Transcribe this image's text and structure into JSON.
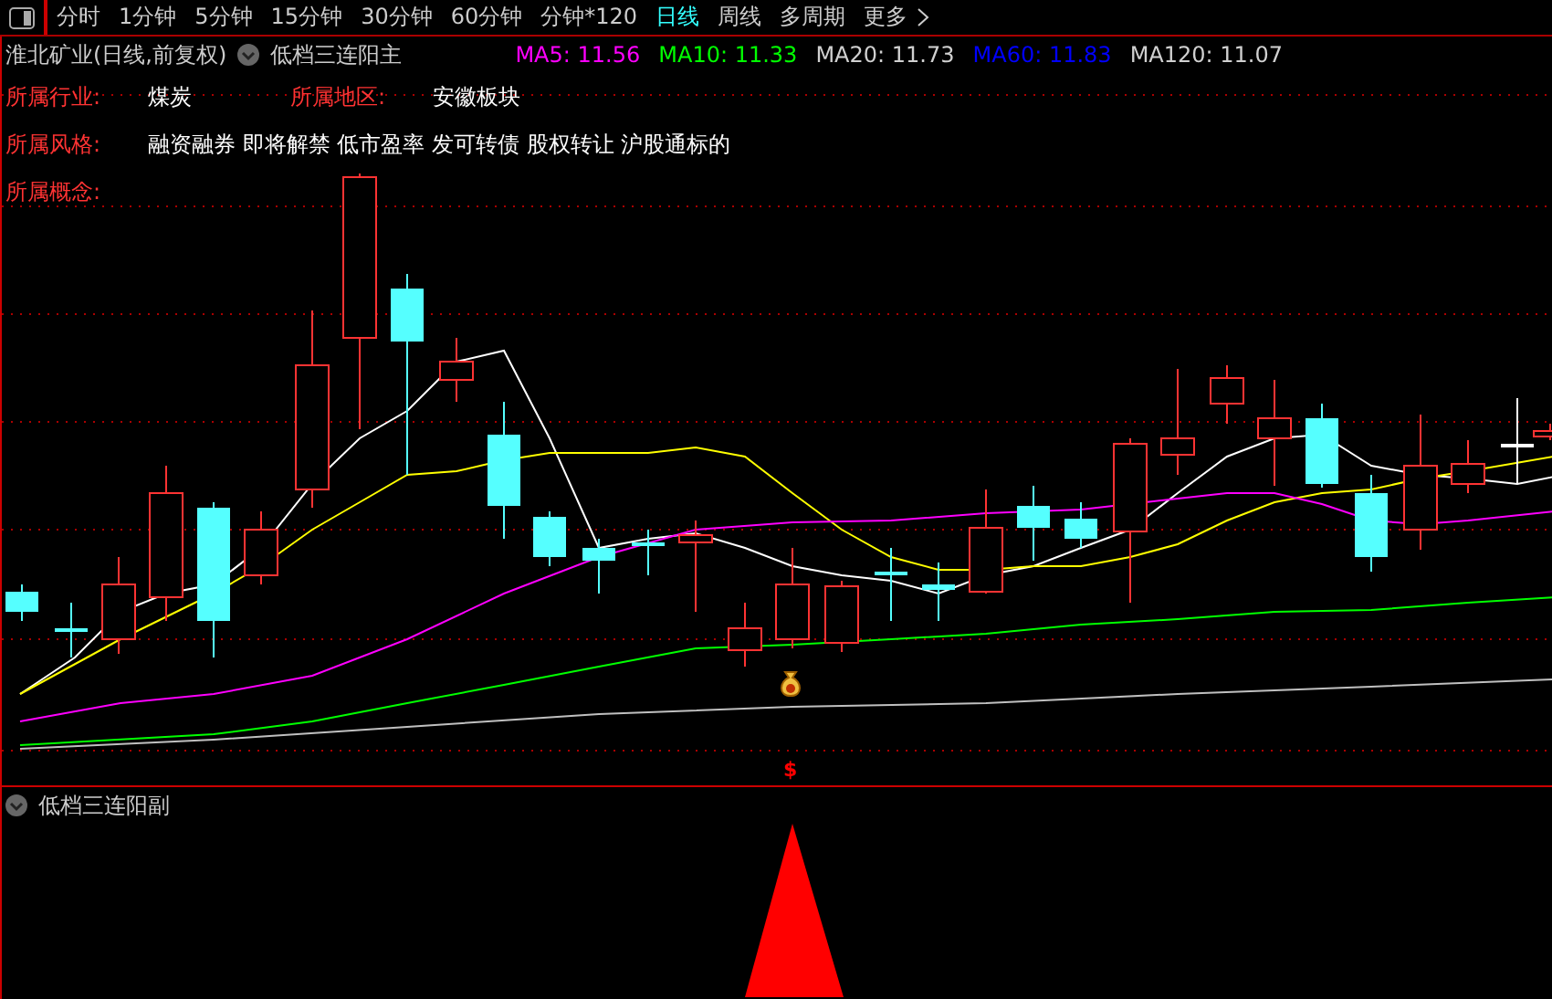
{
  "toolbar": {
    "periods": [
      {
        "label": "分时",
        "selected": false
      },
      {
        "label": "1分钟",
        "selected": false
      },
      {
        "label": "5分钟",
        "selected": false
      },
      {
        "label": "15分钟",
        "selected": false
      },
      {
        "label": "30分钟",
        "selected": false
      },
      {
        "label": "60分钟",
        "selected": false
      },
      {
        "label": "分钟*120",
        "selected": false
      },
      {
        "label": "日线",
        "selected": true
      },
      {
        "label": "周线",
        "selected": false
      },
      {
        "label": "多周期",
        "selected": false
      },
      {
        "label": "更多",
        "selected": false
      }
    ]
  },
  "main_pane": {
    "stock": "淮北矿业(日线,前复权)",
    "indicator": "低档三连阳主",
    "ma": [
      {
        "label": "MA5:",
        "value": "11.56",
        "color": "#ff00ff"
      },
      {
        "label": "MA10:",
        "value": "11.33",
        "color": "#00ff00"
      },
      {
        "label": "MA20:",
        "value": "11.73",
        "color": "#d0d0d0"
      },
      {
        "label": "MA60:",
        "value": "11.83",
        "color": "#0000ff"
      },
      {
        "label": "MA120:",
        "value": "11.07",
        "color": "#d0d0d0"
      }
    ],
    "info": [
      [
        {
          "label": "所属行业:",
          "value": "煤炭"
        },
        {
          "label": "所属地区:",
          "value": "安徽板块"
        }
      ],
      [
        {
          "label": "所属风格:",
          "value": "融资融券 即将解禁 低市盈率 发可转债 股权转让 沪股通标的"
        }
      ],
      [
        {
          "label": "所属概念:"
        }
      ]
    ],
    "signal": "$"
  },
  "sub_pane": {
    "indicator": "低档三连阳副"
  }
}
